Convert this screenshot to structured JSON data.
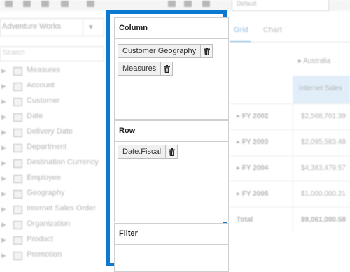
{
  "background": {
    "cube_selector": {
      "value": "Adventure Works"
    },
    "search": {
      "placeholder": "Search"
    },
    "view_select": {
      "value": "Default"
    },
    "tree": [
      {
        "label": "Measures",
        "icon": "folder-icon"
      },
      {
        "label": "Account",
        "icon": "dimension-icon"
      },
      {
        "label": "Customer",
        "icon": "dimension-icon"
      },
      {
        "label": "Date",
        "icon": "dimension-icon"
      },
      {
        "label": "Delivery Date",
        "icon": "dimension-icon"
      },
      {
        "label": "Department",
        "icon": "dimension-icon"
      },
      {
        "label": "Destination Currency",
        "icon": "dimension-icon"
      },
      {
        "label": "Employee",
        "icon": "dimension-icon"
      },
      {
        "label": "Geography",
        "icon": "dimension-icon"
      },
      {
        "label": "Internet Sales Order",
        "icon": "dimension-icon"
      },
      {
        "label": "Organization",
        "icon": "dimension-icon"
      },
      {
        "label": "Product",
        "icon": "dimension-icon"
      },
      {
        "label": "Promotion",
        "icon": "dimension-icon"
      }
    ],
    "tabs": [
      "Grid",
      "Chart"
    ],
    "grid": {
      "column_header": "Australia",
      "measure_header": "Internet Sales",
      "rows": [
        {
          "label": "FY 2002",
          "value": "$2,568,701.39"
        },
        {
          "label": "FY 2003",
          "value": "$2,095,583.48"
        },
        {
          "label": "FY 2004",
          "value": "$4,383,479.57"
        },
        {
          "label": "FY 2005",
          "value": "$1,000,000.21"
        },
        {
          "label": "Total",
          "value": "$9,061,000.58"
        }
      ]
    }
  },
  "panel": {
    "accent_color": "#0a79d1",
    "sections": {
      "column": {
        "title": "Column",
        "items": [
          "Customer Geography",
          "Measures"
        ]
      },
      "row": {
        "title": "Row",
        "items": [
          "Date.Fiscal"
        ]
      },
      "filter": {
        "title": "Filter",
        "items": []
      }
    }
  }
}
